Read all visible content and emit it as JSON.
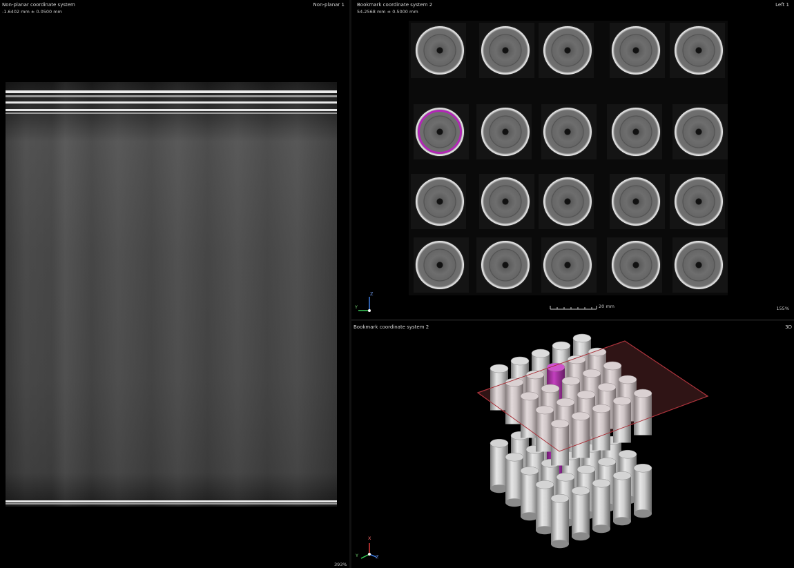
{
  "left_view": {
    "coordinate_system": "Non-planar coordinate system",
    "position": "-1.6402 mm ± 0.0500 mm",
    "view_name": "Non-planar 1",
    "zoom": "393%"
  },
  "top_right_view": {
    "coordinate_system": "Bookmark coordinate system 2",
    "position": "54.2568 mm ± 0.5000 mm",
    "view_name": "Left 1",
    "zoom": "155%",
    "scale_bar_label": "20 mm",
    "axis_vertical": "Z",
    "axis_horizontal": "Y",
    "disc_grid": {
      "rows": 4,
      "cols": 5,
      "selected": [
        1,
        0
      ]
    }
  },
  "bottom_right_view": {
    "coordinate_system": "Bookmark coordinate system 2",
    "view_name": "3D",
    "axis_x": "X",
    "axis_y": "Y",
    "axis_z": "Z"
  },
  "colors": {
    "background": "#000000",
    "selection": "#b227b6",
    "clip_plane": "#a8323a",
    "axis_x": "#e03a3a",
    "axis_y": "#3ad05a",
    "axis_z": "#3a7ae0"
  }
}
